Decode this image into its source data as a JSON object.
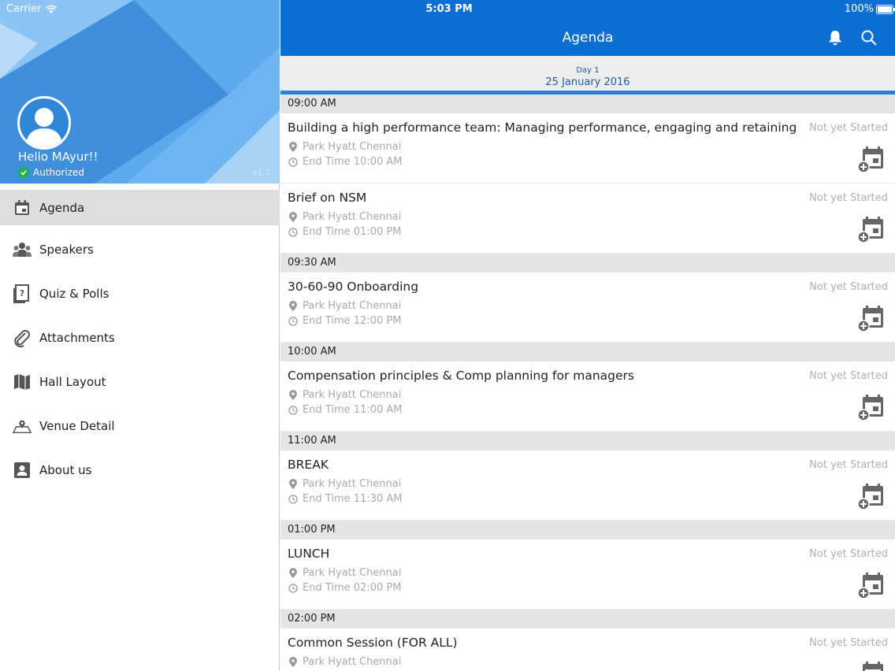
{
  "status_bar": {
    "carrier": "Carrier",
    "time": "5:03 PM",
    "battery": "100%"
  },
  "sidebar": {
    "greeting": "Hello MAyur!!",
    "auth_status": "Authorized",
    "version": "v1.1",
    "menu": [
      {
        "label": "Agenda",
        "icon": "calendar-icon",
        "active": true
      },
      {
        "label": "Speakers",
        "icon": "speakers-icon"
      },
      {
        "label": "Quiz & Polls",
        "icon": "quiz-icon"
      },
      {
        "label": "Attachments",
        "icon": "paperclip-icon"
      },
      {
        "label": "Hall Layout",
        "icon": "map-icon"
      },
      {
        "label": "Venue Detail",
        "icon": "venue-map-icon"
      },
      {
        "label": "About us",
        "icon": "contact-icon"
      }
    ]
  },
  "header": {
    "title": "Agenda"
  },
  "day": {
    "label": "Day 1",
    "date": "25 January 2016"
  },
  "colors": {
    "primary": "#0a6fd0",
    "sidebar_header": "#5da9ee",
    "accent_line": "#2b7fd4",
    "muted_text": "#aaaaaa"
  },
  "agenda": [
    {
      "time": "09:00 AM",
      "sessions": [
        {
          "title": "Building a high performance team: Managing performance, engaging and retaining",
          "status": "Not yet Started",
          "location": "Park Hyatt Chennai",
          "end": "End Time 10:00 AM"
        },
        {
          "title": "Brief on NSM",
          "status": "Not yet Started",
          "location": "Park Hyatt Chennai",
          "end": "End Time 01:00 PM"
        }
      ]
    },
    {
      "time": "09:30 AM",
      "sessions": [
        {
          "title": "30-60-90 Onboarding",
          "status": "Not yet Started",
          "location": "Park Hyatt Chennai",
          "end": "End Time 12:00 PM"
        }
      ]
    },
    {
      "time": "10:00 AM",
      "sessions": [
        {
          "title": "Compensation principles & Comp planning  for managers",
          "status": "Not yet Started",
          "location": "Park Hyatt Chennai",
          "end": "End Time 11:00 AM"
        }
      ]
    },
    {
      "time": "11:00 AM",
      "sessions": [
        {
          "title": "BREAK",
          "status": "Not yet Started",
          "location": "Park Hyatt Chennai",
          "end": "End Time 11:30 AM"
        }
      ]
    },
    {
      "time": "01:00 PM",
      "sessions": [
        {
          "title": "LUNCH",
          "status": "Not yet Started",
          "location": "Park Hyatt Chennai",
          "end": "End Time 02:00 PM"
        }
      ]
    },
    {
      "time": "02:00 PM",
      "sessions": [
        {
          "title": "Common Session (FOR ALL)",
          "status": "Not yet Started",
          "location": "Park Hyatt Chennai",
          "end": ""
        }
      ]
    }
  ]
}
